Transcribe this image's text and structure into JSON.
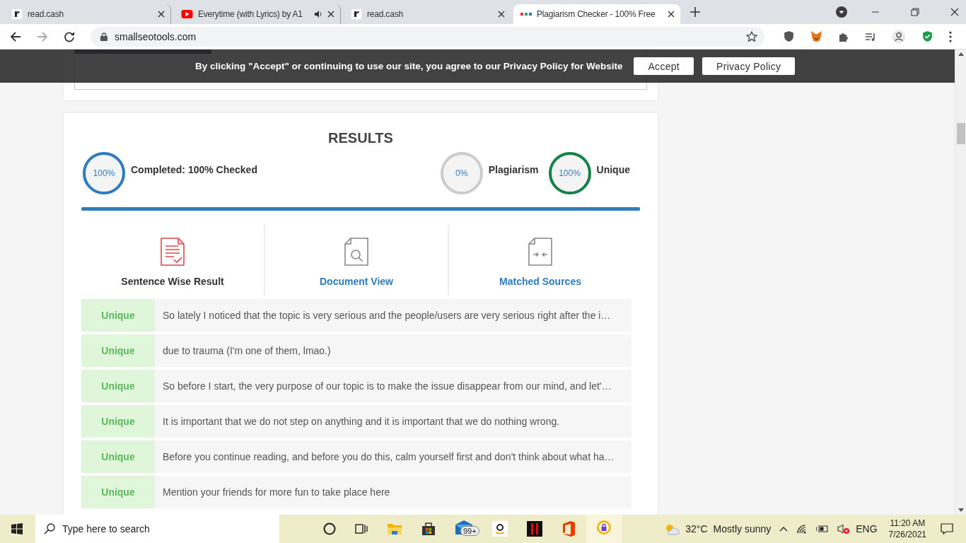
{
  "browser": {
    "tabs": [
      {
        "title": "read.cash",
        "kind": "letter",
        "selected": false,
        "audio": false
      },
      {
        "title": "Everytime (with Lyrics) by A1",
        "kind": "video",
        "selected": false,
        "audio": true
      },
      {
        "title": "read.cash",
        "kind": "letter",
        "selected": false,
        "audio": false
      },
      {
        "title": "Plagiarism Checker - 100% Free",
        "kind": "site",
        "selected": true,
        "audio": false
      }
    ],
    "url": "smallseotools.com"
  },
  "cookie_banner": {
    "message": "By clicking \"Accept\" or continuing to use our site, you agree to our Privacy Policy for Website",
    "buttons": [
      "Accept",
      "Privacy Policy"
    ]
  },
  "results": {
    "title": "RESULTS",
    "stats": [
      {
        "value": "100%",
        "label": "Completed: 100% Checked",
        "color": "#2f7bbf"
      },
      {
        "value": "0%",
        "label": "Plagiarism",
        "color": "#cccccc"
      },
      {
        "value": "100%",
        "label": "Unique",
        "color": "#14804a"
      }
    ],
    "progress": {
      "level": 1
    },
    "views": [
      {
        "label": "Sentence Wise Result",
        "selected": true
      },
      {
        "label": "Document View",
        "selected": false
      },
      {
        "label": "Matched Sources",
        "selected": false
      }
    ],
    "rows": [
      {
        "status": "Unique",
        "text": "So lately I noticed that the topic is very serious and the people/users are very serious right after the i…"
      },
      {
        "status": "Unique",
        "text": "due to trauma (I'm one of them, lmao.)"
      },
      {
        "status": "Unique",
        "text": "So before I start, the very purpose of our topic is to make the issue disappear from our mind, and let'…"
      },
      {
        "status": "Unique",
        "text": "It is important that we do not step on anything and it is important that we do nothing wrong."
      },
      {
        "status": "Unique",
        "text": "Before you continue reading, and before you do this, calm yourself first and don't think about what ha…"
      },
      {
        "status": "Unique",
        "text": "Mention your friends for more fun to take place here"
      }
    ]
  },
  "taskbar": {
    "search_placeholder": "Type here to search",
    "mail_badge": "99+",
    "temperature": "32°C",
    "weather": "Mostly sunny",
    "language": "ENG",
    "time": "11:20 AM",
    "date": "7/26/2021"
  }
}
